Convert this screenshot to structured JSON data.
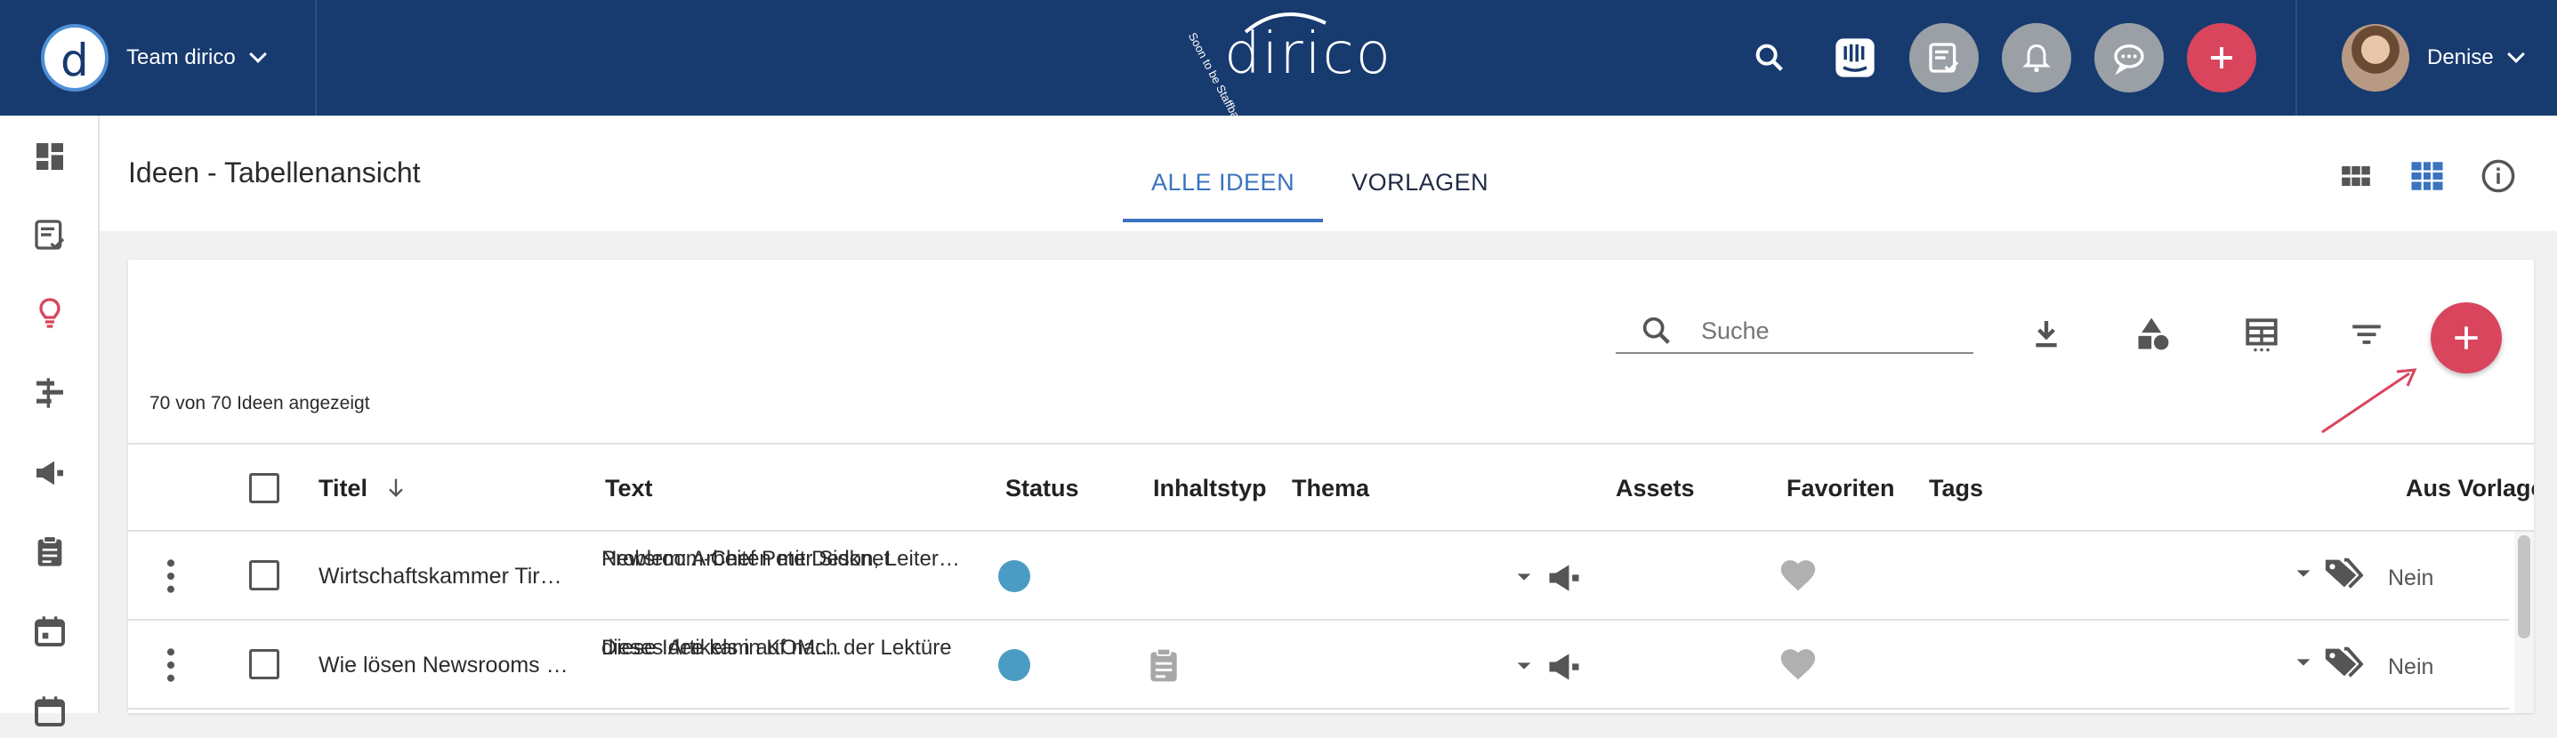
{
  "topbar": {
    "team_name": "Team dirico",
    "brand_name": "dirico",
    "brand_tagline": "Soon to be Staffbase",
    "user_name": "Denise",
    "icons": [
      "search-icon",
      "intercom-icon",
      "checklist-icon",
      "bell-icon",
      "chat-icon",
      "add-icon"
    ],
    "colors": {
      "bar": "#173a6f",
      "accent_red": "#d8455d",
      "icon_grey": "#9aa0a6"
    }
  },
  "sidebar": {
    "items": [
      {
        "icon": "dashboard-icon"
      },
      {
        "icon": "tasks-icon"
      },
      {
        "icon": "lightbulb-icon",
        "active": true
      },
      {
        "icon": "timeline-icon"
      },
      {
        "icon": "megaphone-icon"
      },
      {
        "icon": "clipboard-icon"
      },
      {
        "icon": "calendar-icon"
      },
      {
        "icon": "calendar-icon"
      }
    ]
  },
  "header": {
    "title": "Ideen - Tabellenansicht",
    "tabs": [
      {
        "label": "ALLE IDEEN",
        "active": true
      },
      {
        "label": "VORLAGEN",
        "active": false
      }
    ],
    "view_icons": [
      "grid-view-icon",
      "table-view-icon",
      "info-icon"
    ]
  },
  "toolbar": {
    "search_placeholder": "Suche",
    "count_text": "70 von 70 Ideen angezeigt",
    "tool_icons": [
      "download-icon",
      "shapes-icon",
      "table-columns-icon",
      "filter-icon",
      "add-icon"
    ]
  },
  "table": {
    "columns": [
      "Titel",
      "Text",
      "Status",
      "Inhaltstyp",
      "Thema",
      "Assets",
      "Favoriten",
      "Tags",
      "Aus Vorlage"
    ],
    "rows": [
      {
        "title": "Wirtschaftskammer Tir…",
        "text_line1": "Problem: Arbeiten mit Desknet",
        "text_line2": "Newsroom-Chef Peter Sidon, Leiter…",
        "status_color": "#4a9cc4",
        "content_type_icon": "",
        "from_template": "Nein"
      },
      {
        "title": "Wie lösen Newsrooms …",
        "text_line1": "Diese Idee kam auf nach der Lektüre",
        "text_line2": "dieses Artikels in KOM:…",
        "status_color": "#4a9cc4",
        "content_type_icon": "clipboard-icon",
        "from_template": "Nein"
      }
    ]
  }
}
